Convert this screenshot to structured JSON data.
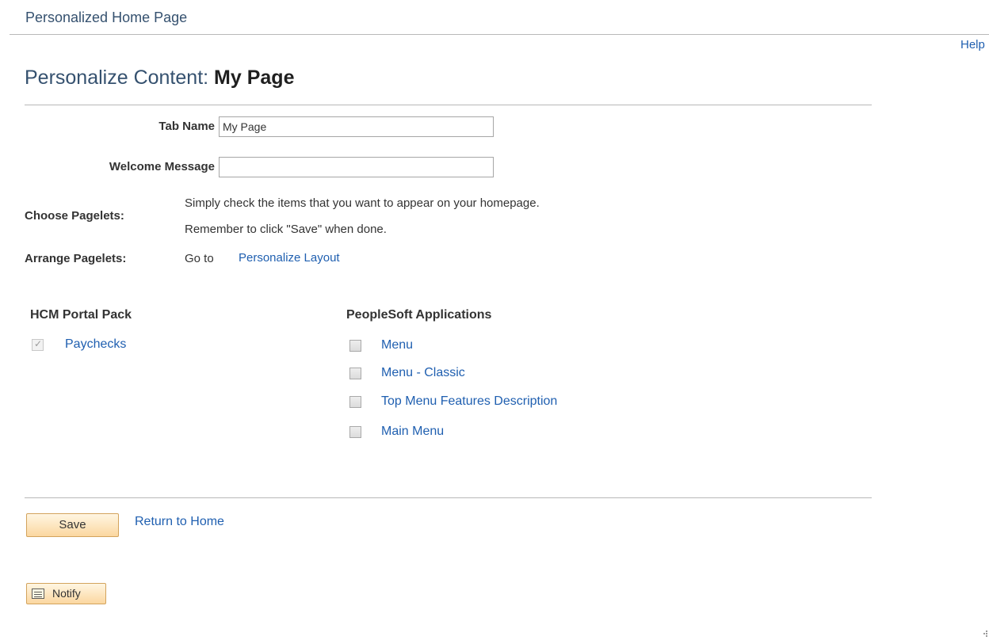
{
  "header": {
    "title": "Personalized Home Page",
    "help_label": "Help"
  },
  "content": {
    "heading_prefix": "Personalize Content:",
    "heading_name": "My Page",
    "tab_name_label": "Tab Name",
    "tab_name_value": "My Page",
    "welcome_label": "Welcome Message",
    "welcome_value": "",
    "choose_label": "Choose Pagelets:",
    "choose_line1": "Simply check the items that you want to appear on your homepage.",
    "choose_line2": "Remember to click \"Save\" when done.",
    "arrange_label": "Arrange Pagelets:",
    "arrange_goto": "Go to",
    "arrange_link": "Personalize Layout"
  },
  "groups": {
    "hcm": {
      "title": "HCM Portal Pack",
      "items": [
        {
          "label": "Paychecks",
          "checked": true,
          "disabled": true
        }
      ]
    },
    "peoplesoft": {
      "title": "PeopleSoft Applications",
      "items": [
        {
          "label": "Menu",
          "checked": false
        },
        {
          "label": "Menu - Classic",
          "checked": false
        },
        {
          "label": "Top Menu Features Description",
          "checked": false
        },
        {
          "label": "Main Menu",
          "checked": false
        }
      ]
    }
  },
  "footer": {
    "save_label": "Save",
    "return_label": "Return to Home",
    "notify_label": "Notify"
  },
  "icons": {
    "notify": "notify-icon",
    "checkbox": "checkbox",
    "resize": "resize-grip-icon"
  }
}
